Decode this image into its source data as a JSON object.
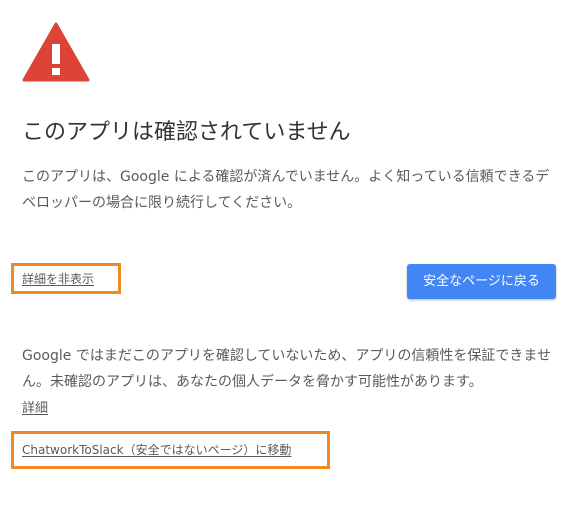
{
  "warning": {
    "icon": "warning-triangle-icon",
    "color": "#db4437"
  },
  "title": "このアプリは確認されていません",
  "description": "このアプリは、Google による確認が済んでいません。よく知っている信頼できるデベロッパーの場合に限り続行してください。",
  "actions": {
    "hide_details_label": "詳細を非表示",
    "back_to_safety_label": "安全なページに戻る"
  },
  "details": {
    "text": "Google ではまだこのアプリを確認していないため、アプリの信頼性を保証できません。未確認のアプリは、あなたの個人データを脅かす可能性があります。",
    "more_link_label": "詳細",
    "proceed_link_label": "ChatworkToSlack（安全ではないページ）に移動"
  },
  "colors": {
    "button_bg": "#4285f4",
    "highlight_border": "#f08a24",
    "text": "#5a5a5a"
  }
}
